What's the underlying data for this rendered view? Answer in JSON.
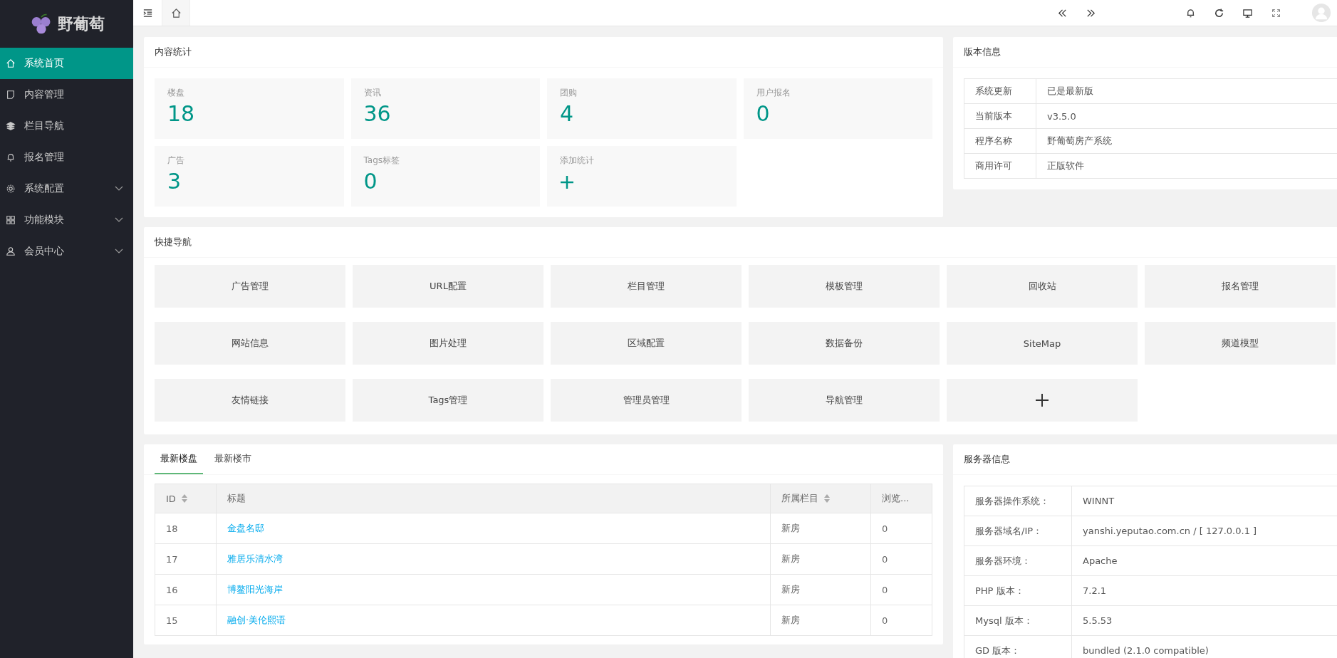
{
  "sidebar": {
    "logo": "野葡萄",
    "items": [
      {
        "label": "系统首页",
        "kind": "home",
        "selected": true,
        "expandable": false
      },
      {
        "label": "内容管理",
        "kind": "doc",
        "selected": false,
        "expandable": false
      },
      {
        "label": "栏目导航",
        "kind": "layers",
        "selected": false,
        "expandable": false
      },
      {
        "label": "报名管理",
        "kind": "bell",
        "selected": false,
        "expandable": false
      },
      {
        "label": "系统配置",
        "kind": "gear",
        "selected": false,
        "expandable": true
      },
      {
        "label": "功能模块",
        "kind": "grid",
        "selected": false,
        "expandable": true
      },
      {
        "label": "会员中心",
        "kind": "user",
        "selected": false,
        "expandable": true
      }
    ]
  },
  "stats": {
    "title": "内容统计",
    "items": [
      {
        "label": "楼盘",
        "value": "18",
        "kind": "count"
      },
      {
        "label": "资讯",
        "value": "36",
        "kind": "count"
      },
      {
        "label": "团购",
        "value": "4",
        "kind": "count"
      },
      {
        "label": "用户报名",
        "value": "0",
        "kind": "count"
      },
      {
        "label": "广告",
        "value": "3",
        "kind": "count"
      },
      {
        "label": "Tags标签",
        "value": "0",
        "kind": "count"
      },
      {
        "label": "添加统计",
        "kind": "add"
      }
    ]
  },
  "version": {
    "title": "版本信息",
    "rows": [
      {
        "key": "系统更新",
        "value": "已是最新版"
      },
      {
        "key": "当前版本",
        "value": "v3.5.0"
      },
      {
        "key": "程序名称",
        "value": "野葡萄房产系统"
      },
      {
        "key": "商用许可",
        "value": "正版软件"
      }
    ]
  },
  "quick_nav": {
    "title": "快捷导航",
    "items": [
      {
        "label": "广告管理",
        "kind": "link"
      },
      {
        "label": "URL配置",
        "kind": "link"
      },
      {
        "label": "栏目管理",
        "kind": "link"
      },
      {
        "label": "模板管理",
        "kind": "link"
      },
      {
        "label": "回收站",
        "kind": "link"
      },
      {
        "label": "报名管理",
        "kind": "link"
      },
      {
        "label": "网站信息",
        "kind": "link"
      },
      {
        "label": "图片处理",
        "kind": "link"
      },
      {
        "label": "区域配置",
        "kind": "link"
      },
      {
        "label": "数据备份",
        "kind": "link"
      },
      {
        "label": "SiteMap",
        "kind": "link"
      },
      {
        "label": "频道模型",
        "kind": "link"
      },
      {
        "label": "友情链接",
        "kind": "link"
      },
      {
        "label": "Tags管理",
        "kind": "link"
      },
      {
        "label": "管理员管理",
        "kind": "link"
      },
      {
        "label": "导航管理",
        "kind": "link"
      },
      {
        "kind": "add"
      }
    ]
  },
  "latest": {
    "tabs": [
      {
        "label": "最新楼盘",
        "selected": true
      },
      {
        "label": "最新楼市",
        "selected": false
      }
    ],
    "table": {
      "columns": [
        {
          "label": "ID",
          "sortable": true
        },
        {
          "label": "标题",
          "sortable": false
        },
        {
          "label": "所属栏目",
          "sortable": true
        },
        {
          "label": "浏览...",
          "sortable": false
        }
      ],
      "rows": [
        {
          "id": "18",
          "title": "金盘名邸",
          "category": "新房",
          "views": "0"
        },
        {
          "id": "17",
          "title": "雅居乐清水湾",
          "category": "新房",
          "views": "0"
        },
        {
          "id": "16",
          "title": "博鳌阳光海岸",
          "category": "新房",
          "views": "0"
        },
        {
          "id": "15",
          "title": "融创·美伦熙语",
          "category": "新房",
          "views": "0"
        }
      ]
    }
  },
  "server": {
    "title": "服务器信息",
    "rows": [
      {
        "key": "服务器操作系统：",
        "value": "WINNT"
      },
      {
        "key": "服务器域名/IP：",
        "value": "yanshi.yeputao.com.cn / [ 127.0.0.1 ]"
      },
      {
        "key": "服务器环境：",
        "value": "Apache"
      },
      {
        "key": "PHP 版本：",
        "value": "7.2.1"
      },
      {
        "key": "Mysql 版本：",
        "value": "5.5.53"
      },
      {
        "key": "GD 版本：",
        "value": "bundled (2.1.0 compatible)"
      }
    ]
  }
}
